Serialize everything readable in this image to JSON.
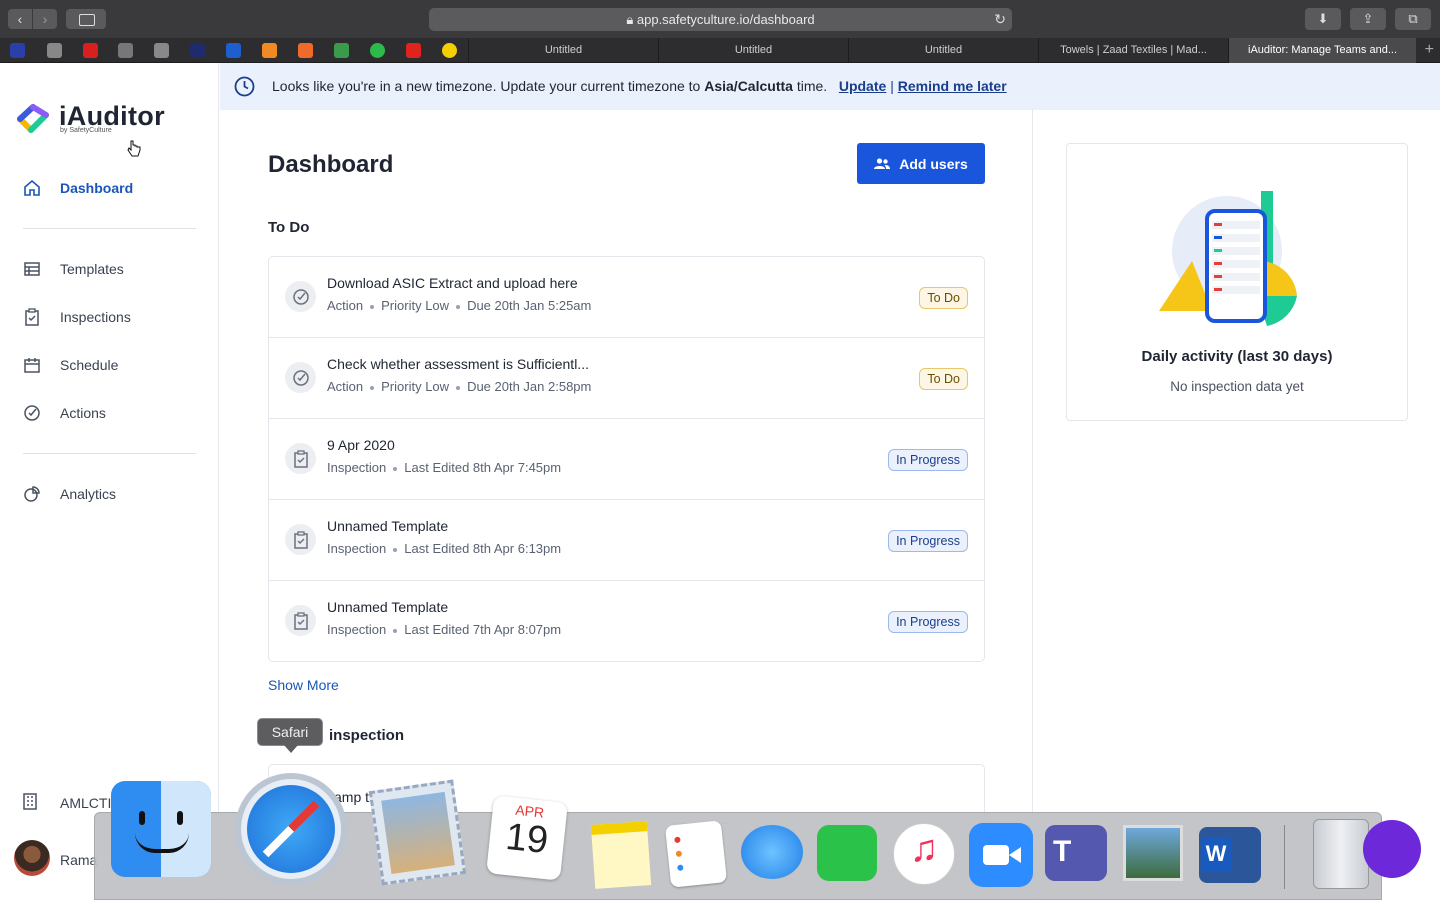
{
  "browser": {
    "url": "app.safetyculture.io/dashboard",
    "tabs": [
      "Untitled",
      "Untitled",
      "Untitled",
      "Towels | Zaad Textiles | Mad...",
      "iAuditor: Manage Teams and..."
    ]
  },
  "banner": {
    "text_before": "Looks like you're in a new timezone. Update your current timezone to ",
    "timezone": "Asia/Calcutta",
    "text_after": " time.",
    "update_link": "Update",
    "separator": "|",
    "remind_link": "Remind me later"
  },
  "sidebar": {
    "logo_text": "iAuditor",
    "logo_sub": "by SafetyCulture",
    "items": [
      {
        "label": "Dashboard",
        "icon": "home-icon"
      },
      {
        "label": "Templates",
        "icon": "templates-icon"
      },
      {
        "label": "Inspections",
        "icon": "clipboard-icon"
      },
      {
        "label": "Schedule",
        "icon": "calendar-icon"
      },
      {
        "label": "Actions",
        "icon": "check-circle-icon"
      },
      {
        "label": "Analytics",
        "icon": "pie-chart-icon"
      }
    ],
    "org": "AMLCTI",
    "user": "Rama"
  },
  "main": {
    "title": "Dashboard",
    "add_users": "Add users",
    "todo_title": "To Do",
    "todo_items": [
      {
        "title": "Download ASIC Extract and upload here",
        "meta": [
          "Action",
          "Priority Low",
          "Due 20th Jan 5:25am"
        ],
        "status": "To Do",
        "kind": "action"
      },
      {
        "title": "Check whether assessment is Sufficientl...",
        "meta": [
          "Action",
          "Priority Low",
          "Due 20th Jan 2:58pm"
        ],
        "status": "To Do",
        "kind": "action"
      },
      {
        "title": "9 Apr 2020",
        "meta": [
          "Inspection",
          "Last Edited 8th Apr 7:45pm"
        ],
        "status": "In Progress",
        "kind": "inspection"
      },
      {
        "title": "Unnamed Template",
        "meta": [
          "Inspection",
          "Last Edited 8th Apr 6:13pm"
        ],
        "status": "In Progress",
        "kind": "inspection"
      },
      {
        "title": "Unnamed Template",
        "meta": [
          "Inspection",
          "Last Edited 7th Apr 8:07pm"
        ],
        "status": "In Progress",
        "kind": "inspection"
      }
    ],
    "show_more": "Show More",
    "start_title": "inspection",
    "start_card_text": "xamp  tionnaire"
  },
  "activity": {
    "title": "Daily activity (last 30 days)",
    "subtitle": "No inspection data yet"
  },
  "tooltip": "Safari",
  "dock": {
    "calendar_month": "APR",
    "calendar_day": "19"
  },
  "colors": {
    "primary": "#1a56db",
    "banner_bg": "#eaf1fd",
    "todo_badge": "#fdf6e4",
    "progress_badge": "#eaf1fd"
  }
}
